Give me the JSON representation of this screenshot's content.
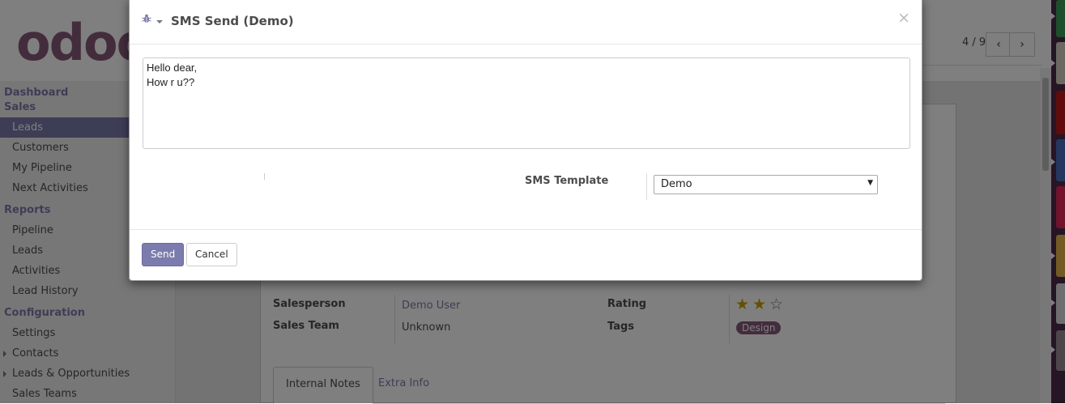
{
  "app": {
    "logo_text": "odoo",
    "pager": {
      "text": "4 / 9",
      "prev_icon": "chevron-left-icon",
      "next_icon": "chevron-right-icon"
    }
  },
  "sidebar": {
    "sections": [
      {
        "title": "Dashboard"
      },
      {
        "title": "Sales",
        "items": [
          "Leads",
          "Customers",
          "My Pipeline",
          "Next Activities"
        ],
        "active": "Leads"
      },
      {
        "title": "Reports",
        "items": [
          "Pipeline",
          "Leads",
          "Activities",
          "Lead History"
        ]
      },
      {
        "title": "Configuration",
        "items": [
          "Settings",
          "Contacts",
          "Leads & Opportunities",
          "Sales Teams"
        ]
      }
    ]
  },
  "record": {
    "salesperson_label": "Salesperson",
    "salesperson_value": "Demo User",
    "sales_team_label": "Sales Team",
    "sales_team_value": "Unknown",
    "rating_label": "Rating",
    "rating": {
      "value": 2,
      "max": 3
    },
    "tags_label": "Tags",
    "tags": [
      "Design"
    ],
    "tabs": [
      "Internal Notes",
      "Extra Info"
    ],
    "active_tab": "Internal Notes"
  },
  "modal": {
    "title": "SMS Send (Demo)",
    "debug_icon": "bug-icon",
    "close_symbol": "×",
    "message_text": "Hello dear,\nHow r u??",
    "template_label": "SMS Template",
    "template_value": "Demo",
    "send_label": "Send",
    "cancel_label": "Cancel"
  },
  "colors": {
    "brand_primary": "#7c7bad",
    "brand_secondary": "#875a7b",
    "overlay": "rgba(0,0,0,0.5)"
  }
}
